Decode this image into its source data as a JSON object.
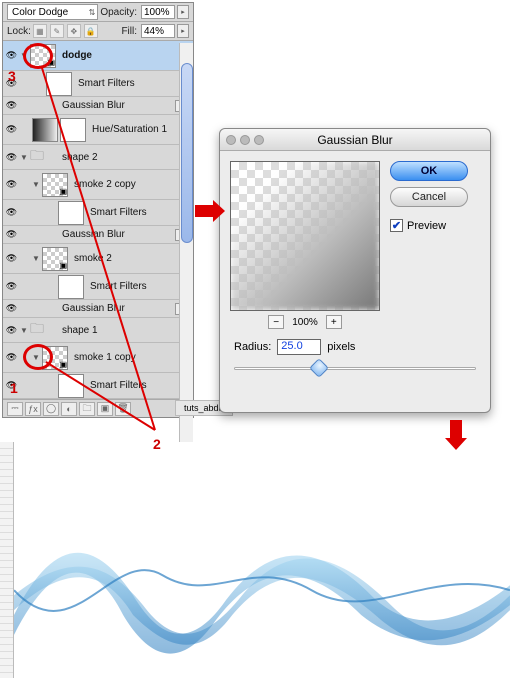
{
  "layers_panel": {
    "blend_mode": "Color Dodge",
    "opacity_label": "Opacity:",
    "opacity_value": "100%",
    "lock_label": "Lock:",
    "fill_label": "Fill:",
    "fill_value": "44%",
    "layers": [
      {
        "name": "dodge",
        "selected": true
      },
      {
        "name": "Smart Filters"
      },
      {
        "name": "Gaussian Blur"
      },
      {
        "name": "Hue/Saturation 1"
      },
      {
        "name": "shape 2"
      },
      {
        "name": "smoke 2 copy"
      },
      {
        "name": "Smart Filters"
      },
      {
        "name": "Gaussian Blur"
      },
      {
        "name": "smoke 2"
      },
      {
        "name": "Smart Filters"
      },
      {
        "name": "Gaussian Blur"
      },
      {
        "name": "shape 1"
      },
      {
        "name": "smoke 1 copy"
      },
      {
        "name": "Smart Filters"
      }
    ]
  },
  "doc_tab": "tuts_abdu",
  "dialog": {
    "title": "Gaussian Blur",
    "ok": "OK",
    "cancel": "Cancel",
    "preview_label": "Preview",
    "preview_checked": true,
    "zoom": "100%",
    "radius_label": "Radius:",
    "radius_value": "25.0",
    "radius_units": "pixels"
  },
  "annotations": {
    "num1": "1",
    "num2": "2",
    "num3": "3"
  }
}
